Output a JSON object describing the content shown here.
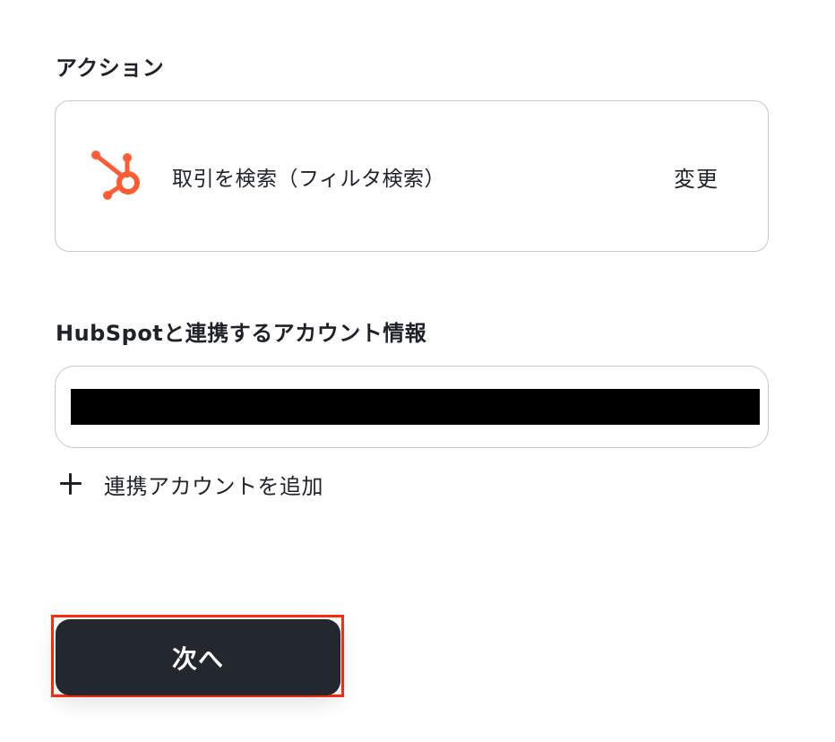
{
  "action": {
    "section_label": "アクション",
    "app_icon": "hubspot-icon",
    "action_name": "取引を検索（フィルタ検索）",
    "change_label": "変更"
  },
  "account": {
    "section_label": "HubSpotと連携するアカウント情報",
    "add_label": "連携アカウントを追加"
  },
  "footer": {
    "next_label": "次へ"
  },
  "colors": {
    "hubspot_orange": "#ff5c35",
    "button_bg": "#23272e",
    "highlight": "#ff2d10"
  }
}
